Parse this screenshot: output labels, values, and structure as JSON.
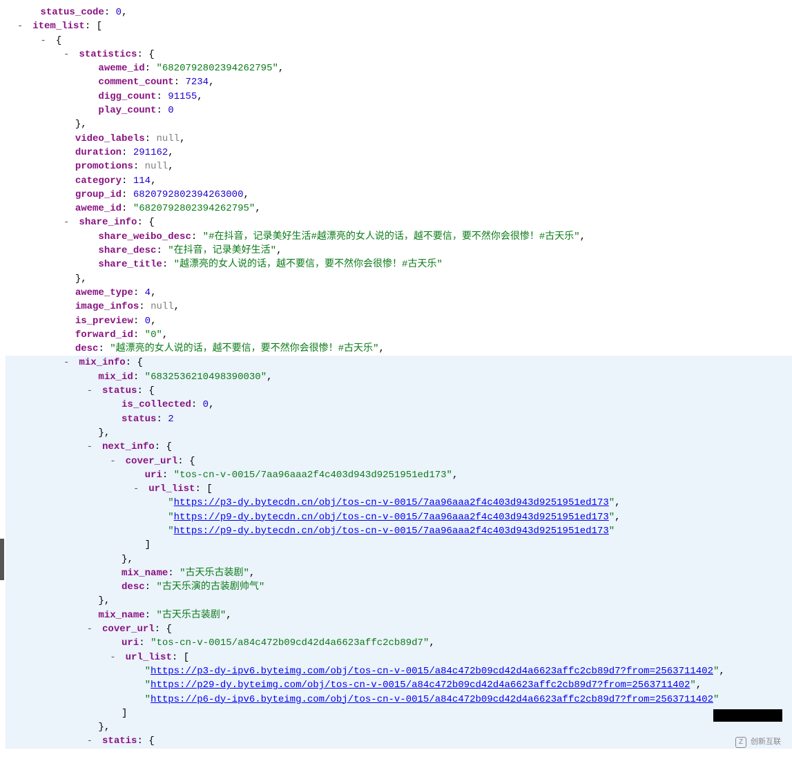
{
  "toggle_glyph": "-",
  "colon": ":",
  "root_truncated": "...",
  "item_list_key": "item_list",
  "brace_open": "{",
  "brace_close": "}",
  "bracket_open": "[",
  "bracket_close": "]",
  "comma": ",",
  "quote": "\"",
  "null_label": "null",
  "statistics": {
    "key": "statistics",
    "aweme_id_key": "aweme_id",
    "aweme_id_val": "6820792802394262795",
    "comment_count_key": "comment_count",
    "comment_count_val": "7234",
    "digg_count_key": "digg_count",
    "digg_count_val": "91155",
    "play_count_key": "play_count",
    "play_count_val": "0"
  },
  "video_labels_key": "video_labels",
  "duration_key": "duration",
  "duration_val": "291162",
  "promotions_key": "promotions",
  "category_key": "category",
  "category_val": "114",
  "group_id_key": "group_id",
  "group_id_val": "6820792802394263000",
  "aweme_id_key": "aweme_id",
  "aweme_id_val": "6820792802394262795",
  "share_info": {
    "key": "share_info",
    "share_weibo_desc_key": "share_weibo_desc",
    "share_weibo_desc_val": "#在抖音，记录美好生活#越漂亮的女人说的话，越不要信，要不然你会很惨！#古天乐",
    "share_desc_key": "share_desc",
    "share_desc_val": "在抖音，记录美好生活",
    "share_title_key": "share_title",
    "share_title_val": "越漂亮的女人说的话，越不要信，要不然你会很惨！#古天乐"
  },
  "aweme_type_key": "aweme_type",
  "aweme_type_val": "4",
  "image_infos_key": "image_infos",
  "is_preview_key": "is_preview",
  "is_preview_val": "0",
  "forward_id_key": "forward_id",
  "forward_id_val": "0",
  "desc_key": "desc",
  "desc_val": "越漂亮的女人说的话，越不要信，要不然你会很惨！#古天乐",
  "mix_info": {
    "key": "mix_info",
    "mix_id_key": "mix_id",
    "mix_id_val": "6832536210498390030",
    "status_key": "status",
    "is_collected_key": "is_collected",
    "is_collected_val": "0",
    "status_inner_key": "status",
    "status_inner_val": "2",
    "next_info_key": "next_info",
    "cover_url_key": "cover_url",
    "uri_key": "uri",
    "uri_val_1": "tos-cn-v-0015/7aa96aaa2f4c403d943d9251951ed173",
    "url_list_key": "url_list",
    "url_list_1": [
      "https://p3-dy.bytecdn.cn/obj/tos-cn-v-0015/7aa96aaa2f4c403d943d9251951ed173",
      "https://p9-dy.bytecdn.cn/obj/tos-cn-v-0015/7aa96aaa2f4c403d943d9251951ed173",
      "https://p9-dy.bytecdn.cn/obj/tos-cn-v-0015/7aa96aaa2f4c403d943d9251951ed173"
    ],
    "mix_name_key": "mix_name",
    "mix_name_val": "古天乐古装剧",
    "desc_key": "desc",
    "desc_val": "古天乐演的古装剧帅气",
    "uri_val_2": "tos-cn-v-0015/a84c472b09cd42d4a6623affc2cb89d7",
    "url_list_2": [
      "https://p3-dy-ipv6.byteimg.com/obj/tos-cn-v-0015/a84c472b09cd42d4a6623affc2cb89d7?from=2563711402",
      "https://p29-dy.byteimg.com/obj/tos-cn-v-0015/a84c472b09cd42d4a6623affc2cb89d7?from=2563711402",
      "https://p6-dy-ipv6.byteimg.com/obj/tos-cn-v-0015/a84c472b09cd42d4a6623affc2cb89d7?from=2563711402"
    ],
    "statis_key": "statis"
  },
  "watermark": "创新互联"
}
